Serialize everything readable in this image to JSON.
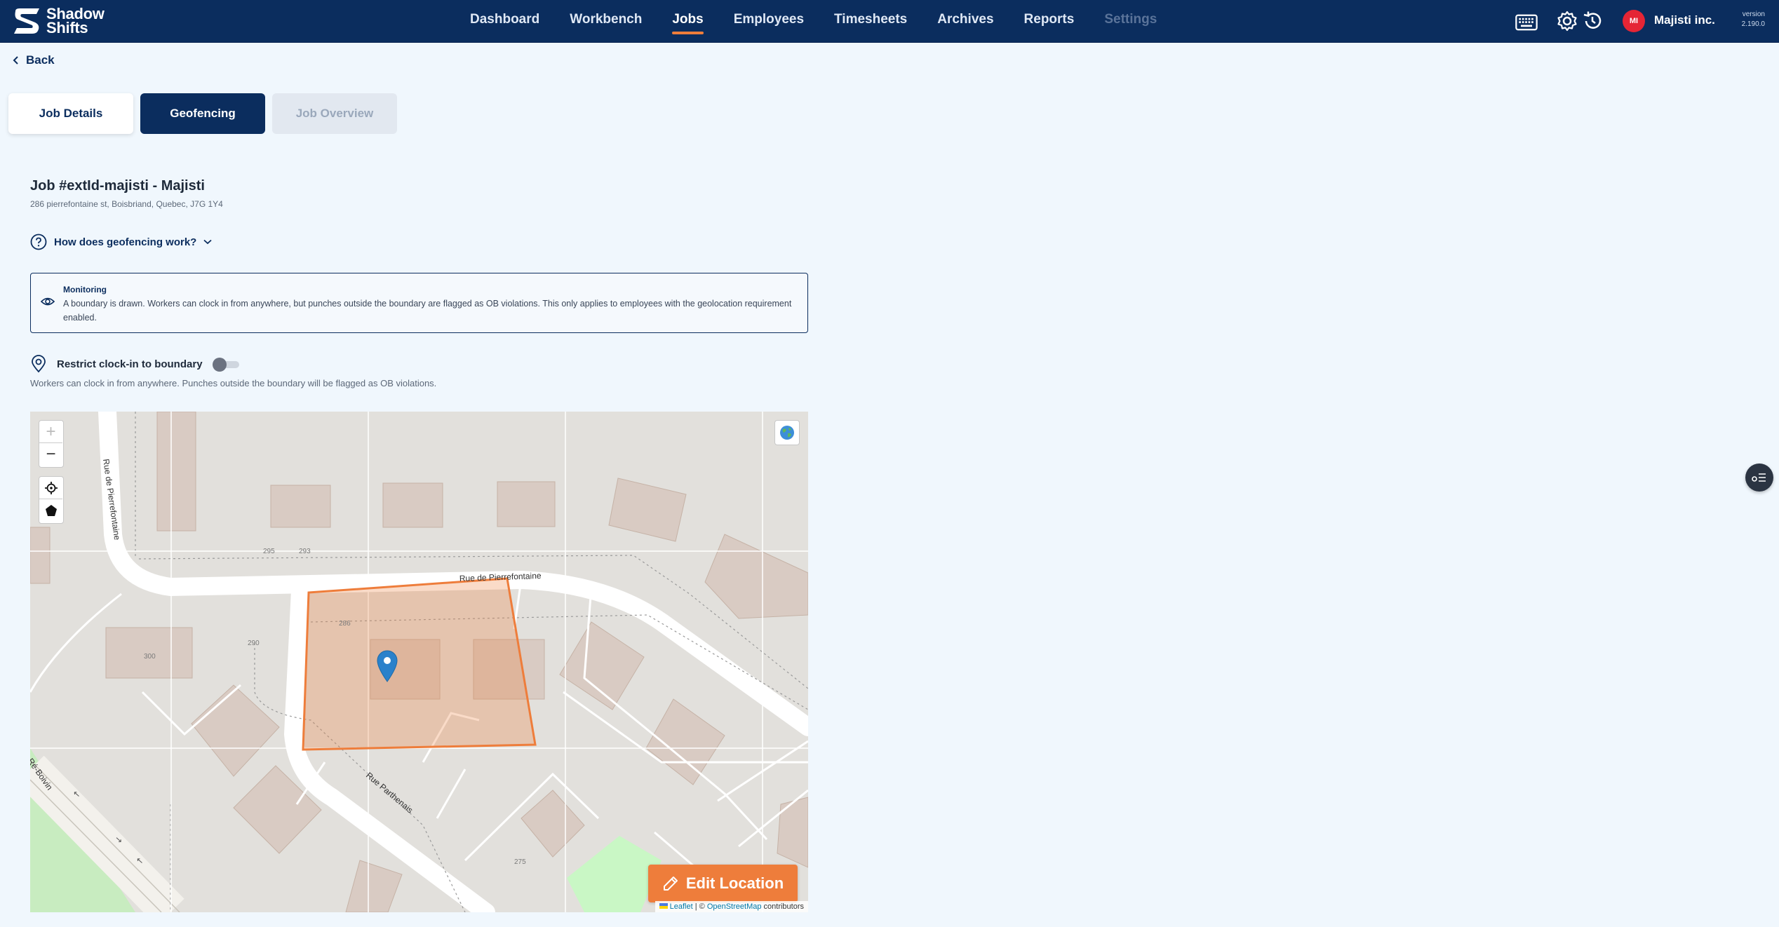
{
  "app": {
    "logo_line1": "Shadow",
    "logo_line2": "Shifts"
  },
  "nav": {
    "items": [
      {
        "label": "Dashboard",
        "state": "normal"
      },
      {
        "label": "Workbench",
        "state": "normal"
      },
      {
        "label": "Jobs",
        "state": "active"
      },
      {
        "label": "Employees",
        "state": "normal"
      },
      {
        "label": "Timesheets",
        "state": "normal"
      },
      {
        "label": "Archives",
        "state": "normal"
      },
      {
        "label": "Reports",
        "state": "normal"
      },
      {
        "label": "Settings",
        "state": "disabled"
      }
    ]
  },
  "user": {
    "initials": "MI",
    "company": "Majisti inc.",
    "version_label": "version",
    "version": "2.190.0"
  },
  "back_label": "Back",
  "tabs": {
    "details": "Job Details",
    "geofencing": "Geofencing",
    "overview": "Job Overview"
  },
  "job": {
    "title": "Job #extId-majisti - Majisti",
    "address": "286 pierrefontaine st, Boisbriand, Quebec, J7G 1Y4"
  },
  "help_label": "How does geofencing work?",
  "monitoring": {
    "title": "Monitoring",
    "body": "A boundary is drawn. Workers can clock in from anywhere, but punches outside the boundary are flagged as OB violations. This only applies to employees with the geolocation requirement enabled."
  },
  "restrict": {
    "label": "Restrict clock-in to boundary",
    "enabled": false,
    "description": "Workers can clock in from anywhere. Punches outside the boundary will be flagged as OB violations."
  },
  "map": {
    "zoom_in": "+",
    "zoom_out": "−",
    "street_labels": {
      "pierrefontaine_vertical": "Rue de Pierrefontaine",
      "pierrefontaine_horizontal": "Rue de Pierrefontaine",
      "parthenais": "Rue Parthenais",
      "boivin": "Ré-Boivin"
    },
    "house_numbers": {
      "a": "295",
      "b": "293",
      "c": "286",
      "d": "290",
      "e": "300",
      "f": "275"
    },
    "edit_button": "Edit Location",
    "attribution_leaflet": "Leaflet",
    "attribution_sep": " | © ",
    "attribution_osm": "OpenStreetMap",
    "attribution_tail": " contributors"
  },
  "colors": {
    "brand": "#0b2d5e",
    "accent": "#ee7d3b",
    "geofence": "#ee7d3b",
    "avatar": "#e52535"
  }
}
